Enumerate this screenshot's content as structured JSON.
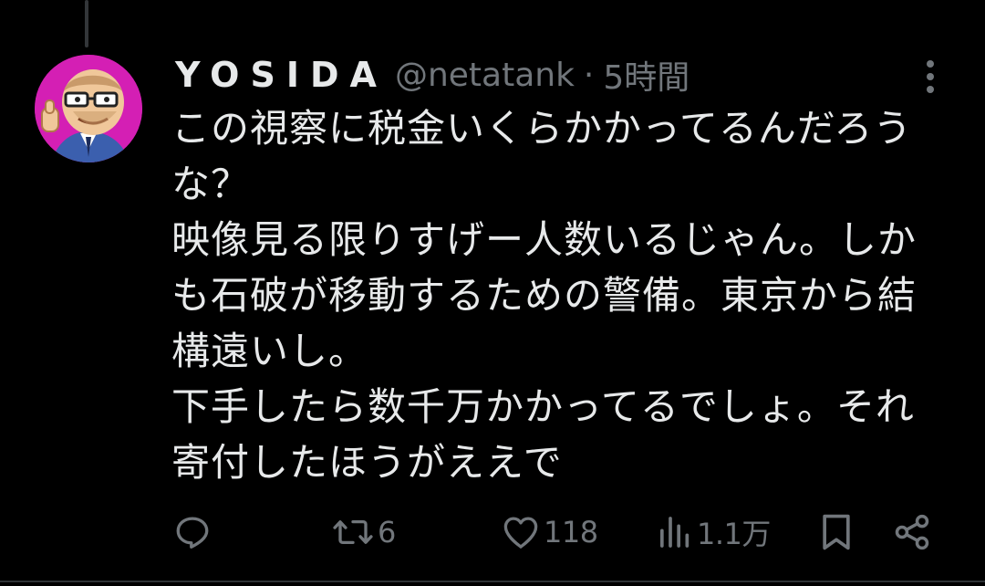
{
  "post": {
    "display_name": "YOSIDA",
    "handle": "@netatank",
    "separator": "·",
    "timestamp": "5時間",
    "body_lines": [
      "この視察に税金いくらかかってるんだろう",
      "な？",
      "映像見る限りすげー人数いるじゃん。しか",
      "も石破が移動するための警備。東京から結",
      "構遠いし。",
      "下手したら数千万かかってるでしょ。それ",
      "寄付したほうがええで"
    ]
  },
  "actions": {
    "reply": {
      "icon": "reply-icon",
      "count": ""
    },
    "repost": {
      "icon": "repost-icon",
      "count": "6"
    },
    "like": {
      "icon": "heart-icon",
      "count": "118"
    },
    "views": {
      "icon": "views-icon",
      "count": "1.1万"
    },
    "bookmark": {
      "icon": "bookmark-icon"
    },
    "share": {
      "icon": "share-icon"
    }
  },
  "colors": {
    "background": "#000000",
    "text_primary": "#e7e9ea",
    "text_secondary": "#71767b",
    "avatar_background": "#d41fb4"
  }
}
